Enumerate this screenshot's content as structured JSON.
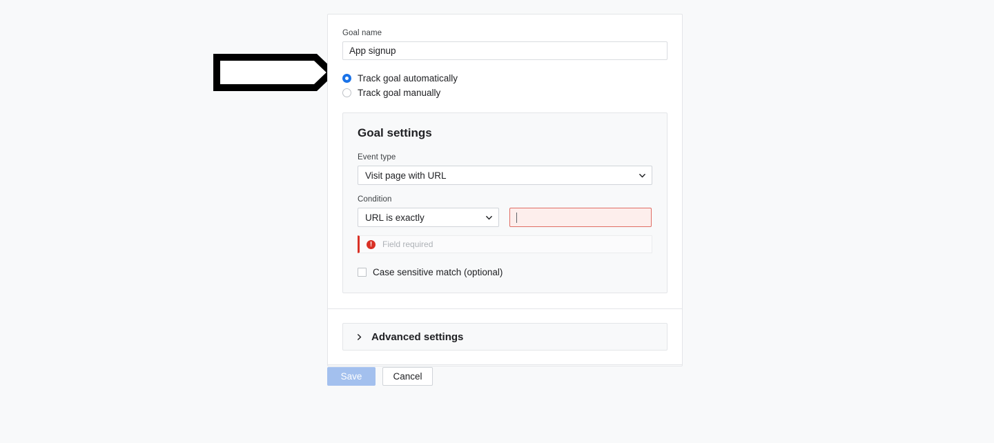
{
  "page": {
    "background_color": "#f8f9fa"
  },
  "annotation": {
    "arrow_icon": "right-arrow-outline",
    "color": "#000000"
  },
  "form": {
    "goal_name": {
      "label": "Goal name",
      "value": "App signup",
      "placeholder": "Goal name"
    },
    "tracking_mode": {
      "options": [
        {
          "label": "Track goal automatically",
          "selected": true
        },
        {
          "label": "Track goal manually",
          "selected": false
        }
      ],
      "selected_color": "#1a73e8"
    },
    "goal_settings": {
      "title": "Goal settings",
      "event_type": {
        "label": "Event type",
        "value": "Visit page with URL",
        "chevron_icon": "chevron-down-icon"
      },
      "condition": {
        "label": "Condition",
        "operator_value": "URL is exactly",
        "operator_chevron_icon": "chevron-down-icon",
        "value": "",
        "value_placeholder": "",
        "error_state": true,
        "error_border_color": "#e06c63",
        "error_background_color": "#fdeeec"
      },
      "error": {
        "icon": "error-exclamation-icon",
        "icon_glyph": "!",
        "text": "Field required",
        "accent_color": "#d93025"
      },
      "case_sensitive": {
        "label": "Case sensitive match (optional)",
        "checked": false
      }
    },
    "advanced_settings": {
      "label": "Advanced settings",
      "chevron_icon": "chevron-right-icon",
      "expanded": false
    }
  },
  "footer": {
    "save_label": "Save",
    "save_disabled": true,
    "save_color": "#a3c0ee",
    "cancel_label": "Cancel"
  }
}
